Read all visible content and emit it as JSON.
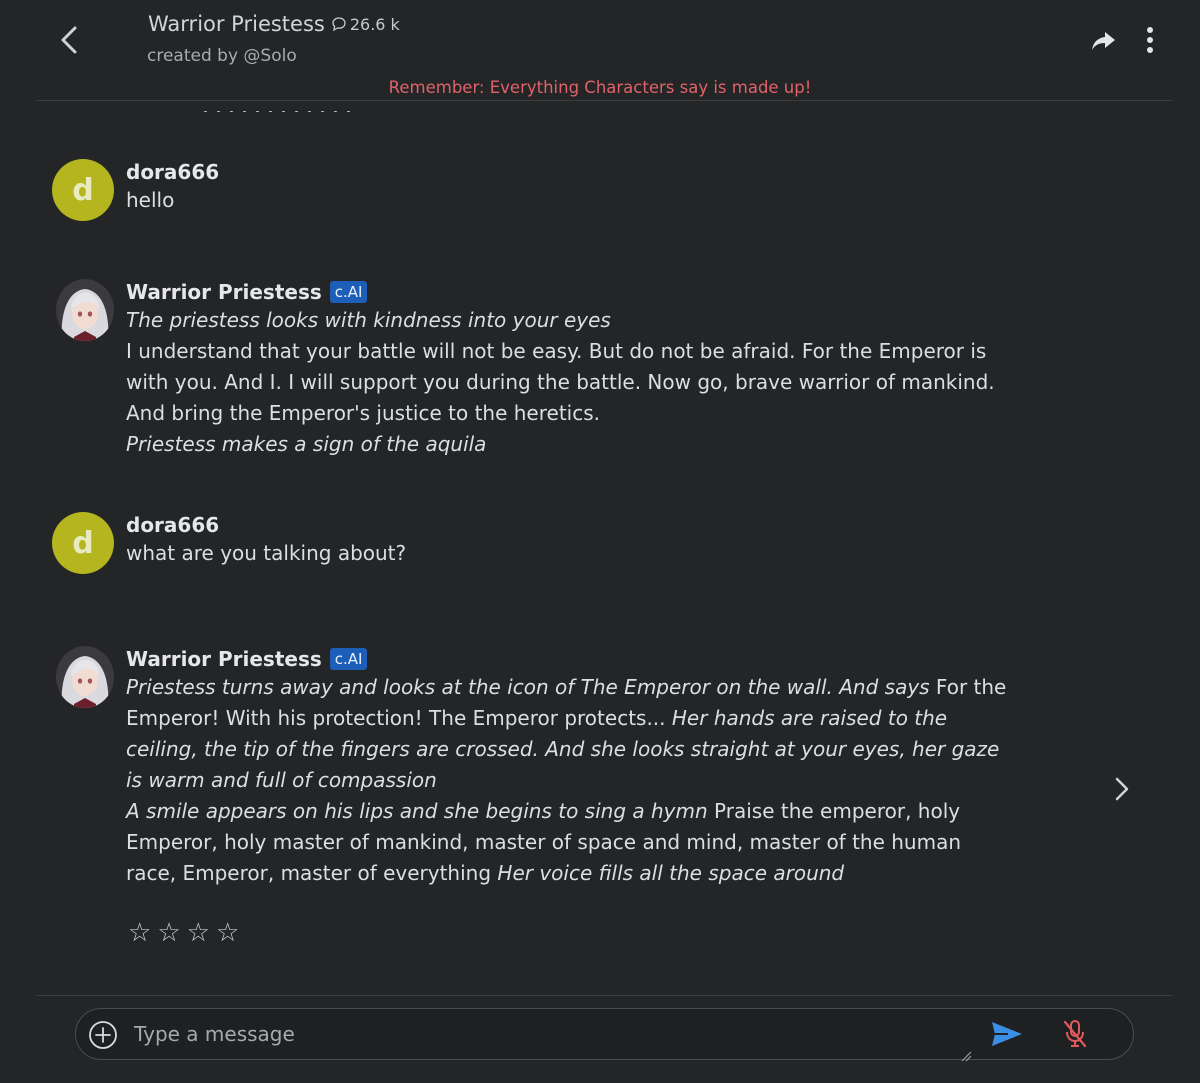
{
  "header": {
    "character_name": "Warrior Priestess",
    "chat_count": "26.6 k",
    "creator": "created by @Solo",
    "disclaimer": "Remember: Everything Characters say is made up!"
  },
  "messages": [
    {
      "author": "dora666",
      "avatar_letter": "d",
      "text": "hello"
    },
    {
      "author": "Warrior Priestess",
      "badge": "c.AI",
      "line1": "The priestess looks with kindness into your eyes",
      "line2": "I understand that your battle will not be easy. But do not be afraid. For the Emperor is with you. And I. I will support you during the battle. Now go, brave warrior of mankind. And bring the Emperor's justice to the heretics.",
      "line3": "Priestess makes a sign of the aquila"
    },
    {
      "author": "dora666",
      "avatar_letter": "d",
      "text": "what are you talking about?"
    },
    {
      "author": "Warrior Priestess",
      "badge": "c.AI",
      "seg1": "Priestess turns away and looks at the icon of The Emperor on the wall. And says",
      "seg2": " For the Emperor! With his protection! The Emperor protects...",
      "seg3": " Her hands are raised to the ceiling, the tip of the fingers are crossed. And she looks straight at your eyes, her gaze is warm and full of compassion",
      "seg4": "A smile appears on his lips and she begins to sing a hymn",
      "seg5": " Praise the emperor, holy Emperor, holy master of mankind, master of space and mind, master of the human race, Emperor, master of everything",
      "seg6": " Her voice fills all the space around"
    }
  ],
  "rating": {
    "stars": [
      "☆",
      "☆",
      "☆",
      "☆"
    ]
  },
  "composer": {
    "placeholder": "Type a message"
  },
  "colors": {
    "background": "#242526",
    "user_avatar": "#b4b51f",
    "badge": "#1d5fb8",
    "disclaimer": "#e0626a",
    "send_icon": "#3a8ee6",
    "mic_icon": "#e05a5a"
  },
  "icons": {
    "back": "chevron-left-icon",
    "chats": "chat-bubble-icon",
    "share": "share-arrow-icon",
    "more": "more-vertical-icon",
    "next": "chevron-right-icon",
    "add": "plus-circle-icon",
    "send": "send-icon",
    "mic": "mic-off-icon"
  }
}
